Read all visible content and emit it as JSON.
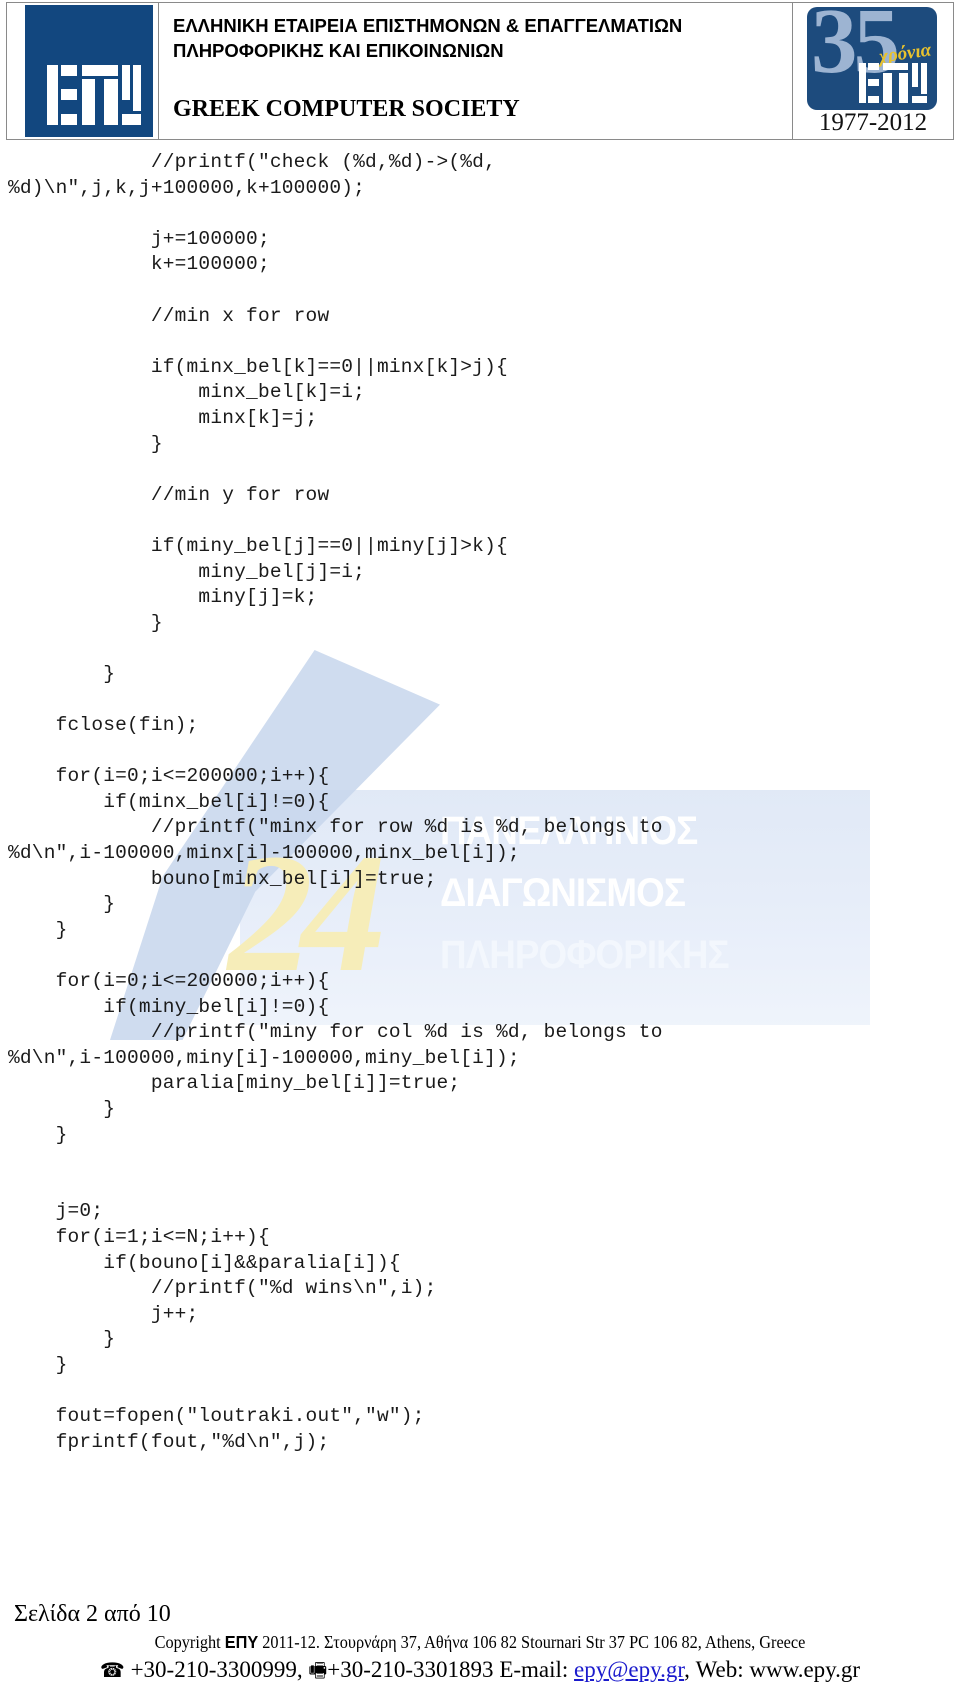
{
  "header": {
    "org_line1": "ΕΛΛΗΝΙΚΗ ΕΤΑΙΡΕΙΑ ΕΠΙΣΤΗΜΟΝΩΝ & ΕΠΑΓΓΕΛΜΑΤΙΩΝ",
    "org_line2": "ΠΛΗΡΟΦΟΡΙΚΗΣ ΚΑΙ ΕΠΙΚΟΙΝΩΝΙΩΝ",
    "org_english": "GREEK COMPUTER SOCIETY",
    "logo_alt": "ΕΠΥ",
    "anniversary": {
      "number": "35",
      "word": "χρόνια",
      "years": "1977-2012",
      "mark": "ΕΠΥ"
    },
    "colors": {
      "logo_blue": "#12477f",
      "badge_blue": "#1d4b7d",
      "number_blue": "#9db4d2",
      "gold": "#e8c22e"
    }
  },
  "watermark": {
    "number": "24",
    "line1": "ΠΑΝΕΛΛΗΝΙΟΣ",
    "line2": "ΔΙΑΓΩΝΙΣΜΟΣ",
    "line3": "ΠΛΗΡΟΦΟΡΙΚΗΣ",
    "colors": {
      "band": "#dfe8f6",
      "swoosh": "#c7d6ec",
      "number": "#f6edb9",
      "text": "#ffffff"
    }
  },
  "code": {
    "language": "c",
    "lines": [
      "            //printf(\"check (%d,%d)->(%d,",
      "%d)\\n\",j,k,j+100000,k+100000);",
      "",
      "            j+=100000;",
      "            k+=100000;",
      "",
      "            //min x for row",
      "",
      "            if(minx_bel[k]==0||minx[k]>j){",
      "                minx_bel[k]=i;",
      "                minx[k]=j;",
      "            }",
      "",
      "            //min y for row",
      "",
      "            if(miny_bel[j]==0||miny[j]>k){",
      "                miny_bel[j]=i;",
      "                miny[j]=k;",
      "            }",
      "",
      "        }",
      "",
      "    fclose(fin);",
      "",
      "    for(i=0;i<=200000;i++){",
      "        if(minx_bel[i]!=0){",
      "            //printf(\"minx for row %d is %d, belongs to",
      "%d\\n\",i-100000,minx[i]-100000,minx_bel[i]);",
      "            bouno[minx_bel[i]]=true;",
      "        }",
      "    }",
      "",
      "    for(i=0;i<=200000;i++){",
      "        if(miny_bel[i]!=0){",
      "            //printf(\"miny for col %d is %d, belongs to",
      "%d\\n\",i-100000,miny[i]-100000,miny_bel[i]);",
      "            paralia[miny_bel[i]]=true;",
      "        }",
      "    }",
      "",
      "",
      "    j=0;",
      "    for(i=1;i<=N;i++){",
      "        if(bouno[i]&&paralia[i]){",
      "            //printf(\"%d wins\\n\",i);",
      "            j++;",
      "        }",
      "    }",
      "",
      "    fout=fopen(\"loutraki.out\",\"w\");",
      "    fprintf(fout,\"%d\\n\",j);"
    ]
  },
  "footer": {
    "page_label": "Σελίδα 2 από 10",
    "copyright_prefix": "Copyright ",
    "copyright_mark": "ΕΠΥ",
    "copyright_rest": " 2011-12. Στουρνάρη 37, Αθήνα 106 82 Stournari Str 37 PC 106 82, Athens, Greece",
    "phone_icon": "☎",
    "phone": "+30-210-3300999,",
    "fax_icon": "🖷",
    "fax": "+30-210-3301893",
    "email_label": "E-mail:",
    "email": "epy@epy.gr",
    "email_suffix": ",",
    "web_label": "Web:",
    "web": "www.epy.gr",
    "link_color": "#1a1acc"
  }
}
